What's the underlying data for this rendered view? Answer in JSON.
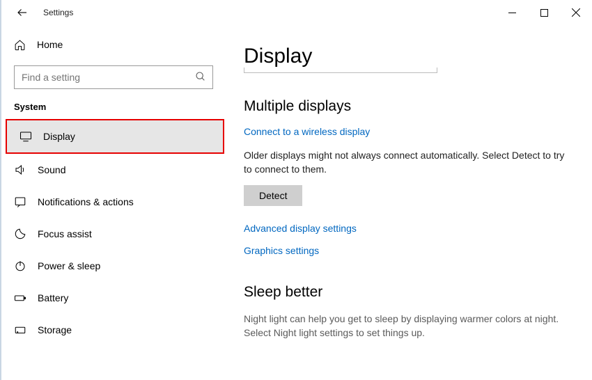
{
  "window": {
    "title": "Settings"
  },
  "sidebar": {
    "home_label": "Home",
    "search_placeholder": "Find a setting",
    "category_label": "System",
    "items": [
      {
        "label": "Display"
      },
      {
        "label": "Sound"
      },
      {
        "label": "Notifications & actions"
      },
      {
        "label": "Focus assist"
      },
      {
        "label": "Power & sleep"
      },
      {
        "label": "Battery"
      },
      {
        "label": "Storage"
      }
    ]
  },
  "main": {
    "page_title": "Display",
    "multiple_displays": {
      "heading": "Multiple displays",
      "connect_link": "Connect to a wireless display",
      "detect_text": "Older displays might not always connect automatically. Select Detect to try to connect to them.",
      "detect_button": "Detect",
      "advanced_link": "Advanced display settings",
      "graphics_link": "Graphics settings"
    },
    "sleep_better": {
      "heading": "Sleep better",
      "body": "Night light can help you get to sleep by displaying warmer colors at night. Select Night light settings to set things up."
    }
  }
}
